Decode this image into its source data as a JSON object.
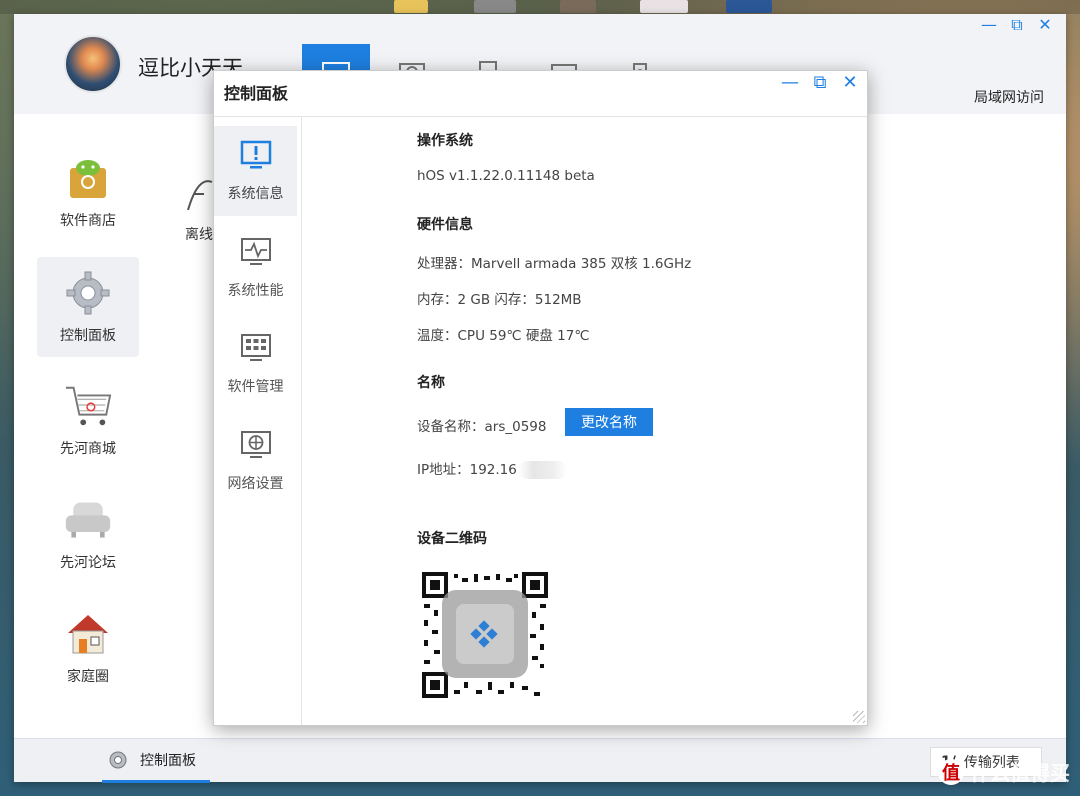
{
  "app": {
    "username": "逗比小天天",
    "lan_access": "局域网访问",
    "controls": {
      "minimize": "—",
      "maximize": "⧉",
      "close": "✕"
    },
    "nav_tabs": [
      {
        "name": "desktop",
        "icon": "monitor-icon",
        "active": true
      },
      {
        "name": "cloud",
        "icon": "cloud-folder-icon",
        "active": false
      },
      {
        "name": "phone",
        "icon": "phone-icon",
        "active": false
      },
      {
        "name": "message",
        "icon": "message-icon",
        "active": false
      },
      {
        "name": "user",
        "icon": "shield-icon",
        "active": false
      }
    ],
    "apps": [
      {
        "label": "软件商店",
        "icon": "android-store-icon"
      },
      {
        "label": "离线",
        "icon": "offline-download-icon"
      },
      {
        "label": "控制面板",
        "icon": "gear-icon",
        "selected": true
      },
      {
        "label": "先河商城",
        "icon": "shopping-cart-icon"
      },
      {
        "label": "先河论坛",
        "icon": "sofa-icon"
      },
      {
        "label": "家庭圈",
        "icon": "house-icon"
      }
    ],
    "bottom": {
      "tab_label": "控制面板",
      "transfer_prefix": "1/",
      "transfer_label": "传输列表"
    }
  },
  "dialog": {
    "title": "控制面板",
    "controls": {
      "minimize": "—",
      "maximize": "⧉",
      "close": "✕"
    },
    "sidebar": [
      {
        "label": "系统信息",
        "icon": "monitor-alert-icon",
        "active": true
      },
      {
        "label": "系统性能",
        "icon": "performance-monitor-icon",
        "active": false
      },
      {
        "label": "软件管理",
        "icon": "grid-app-icon",
        "active": false
      },
      {
        "label": "网络设置",
        "icon": "globe-monitor-icon",
        "active": false
      }
    ],
    "content": {
      "os_title": "操作系统",
      "os_version": "hOS v1.1.22.0.11148 beta",
      "hw_title": "硬件信息",
      "cpu": "处理器：Marvell armada 385 双核 1.6GHz",
      "memory": "内存：2 GB 闪存：512MB",
      "temperature": "温度：CPU 59℃ 硬盘 17℃",
      "name_title": "名称",
      "device_name": "设备名称：ars_0598",
      "rename_button": "更改名称",
      "ip": "IP地址：192.16",
      "qr_title": "设备二维码"
    }
  },
  "watermark": {
    "badge": "值",
    "text": "什么值得买"
  },
  "colors": {
    "accent": "#1e7fe0",
    "header_bg": "#f1f3f6"
  }
}
